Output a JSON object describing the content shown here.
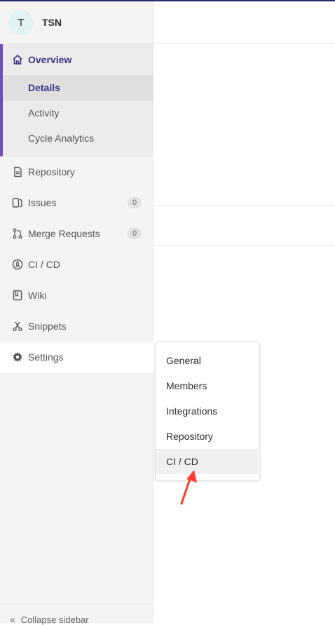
{
  "project": {
    "avatar_letter": "T",
    "name": "TSN"
  },
  "sidebar": {
    "overview": {
      "label": "Overview",
      "icon": "home-icon",
      "subitems": [
        {
          "label": "Details",
          "active": true
        },
        {
          "label": "Activity",
          "active": false
        },
        {
          "label": "Cycle Analytics",
          "active": false
        }
      ]
    },
    "items": [
      {
        "label": "Repository",
        "icon": "document-icon"
      },
      {
        "label": "Issues",
        "icon": "issues-icon",
        "count": "0"
      },
      {
        "label": "Merge Requests",
        "icon": "merge-request-icon",
        "count": "0"
      },
      {
        "label": "CI / CD",
        "icon": "rocket-icon"
      },
      {
        "label": "Wiki",
        "icon": "book-icon"
      },
      {
        "label": "Snippets",
        "icon": "scissors-icon"
      },
      {
        "label": "Settings",
        "icon": "gear-icon"
      }
    ],
    "collapse_label": "Collapse sidebar"
  },
  "settings_flyout": {
    "items": [
      "General",
      "Members",
      "Integrations",
      "Repository",
      "CI / CD"
    ],
    "highlighted": "CI / CD"
  },
  "colors": {
    "accent": "#6b4fbb",
    "active_text": "#3a3388",
    "annotation_arrow": "#ff3b30"
  }
}
